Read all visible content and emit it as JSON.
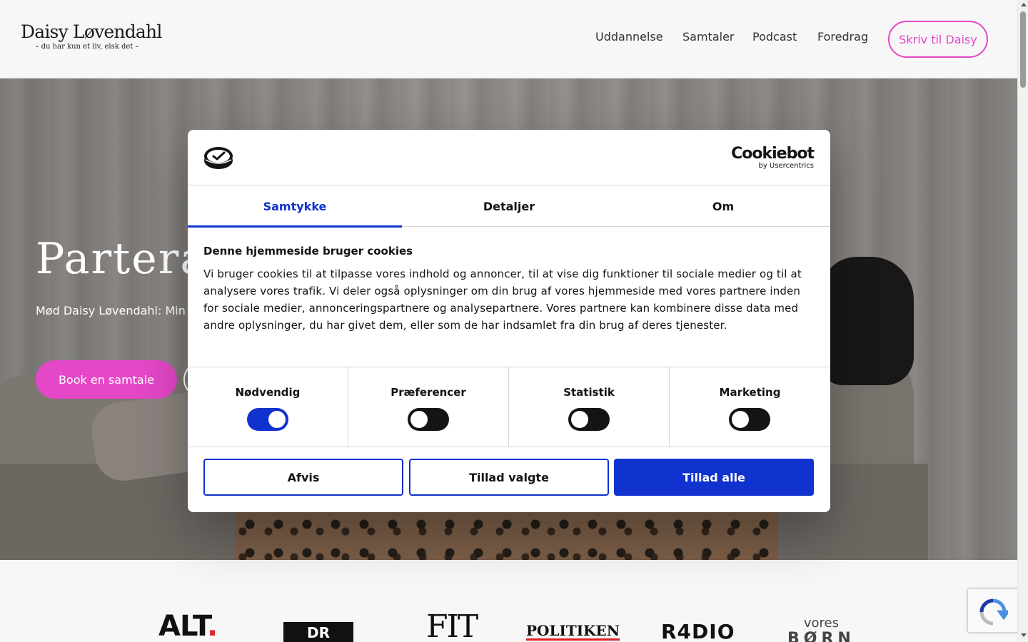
{
  "header": {
    "logo_name": "Daisy Løvendahl",
    "logo_tagline": "– du har kun et liv, elsk det –",
    "nav": [
      "Uddannelse",
      "Samtaler",
      "Podcast",
      "Foredrag"
    ],
    "cta_label": "Skriv til Daisy"
  },
  "hero": {
    "title": "Parterap",
    "subtitle": "Mød Daisy Løvendahl: Min",
    "book_button": "Book en samtale"
  },
  "press_logos": {
    "alt": "ALT",
    "dr": "DR",
    "fit": "FIT",
    "politiken": "POLITIKEN",
    "radio": "R4DIO",
    "vores": "vores",
    "born": "BØRN"
  },
  "cookie_dialog": {
    "brand_name": "Cookiebot",
    "brand_by": "by Usercentrics",
    "tabs": [
      "Samtykke",
      "Detaljer",
      "Om"
    ],
    "active_tab": "Samtykke",
    "title": "Denne hjemmeside bruger cookies",
    "body": "Vi bruger cookies til at tilpasse vores indhold og annoncer, til at vise dig funktioner til sociale medier og til at analysere vores trafik. Vi deler også oplysninger om din brug af vores hjemmeside med vores partnere inden for sociale medier, annonceringspartnere og analysepartnere. Vores partnere kan kombinere disse data med andre oplysninger, du har givet dem, eller som de har indsamlet fra din brug af deres tjenester.",
    "toggles": [
      {
        "label": "Nødvendig",
        "on": true
      },
      {
        "label": "Præferencer",
        "on": false
      },
      {
        "label": "Statistik",
        "on": false
      },
      {
        "label": "Marketing",
        "on": false
      }
    ],
    "buttons": {
      "reject": "Afvis",
      "allow_selected": "Tillad valgte",
      "allow_all": "Tillad alle"
    }
  },
  "colors": {
    "accent_pink": "#e447c7",
    "cookiebot_blue": "#1032cf"
  },
  "icons": {
    "cookiebot_logo": "cookiebot-logo-icon",
    "recaptcha": "recaptcha-icon"
  }
}
